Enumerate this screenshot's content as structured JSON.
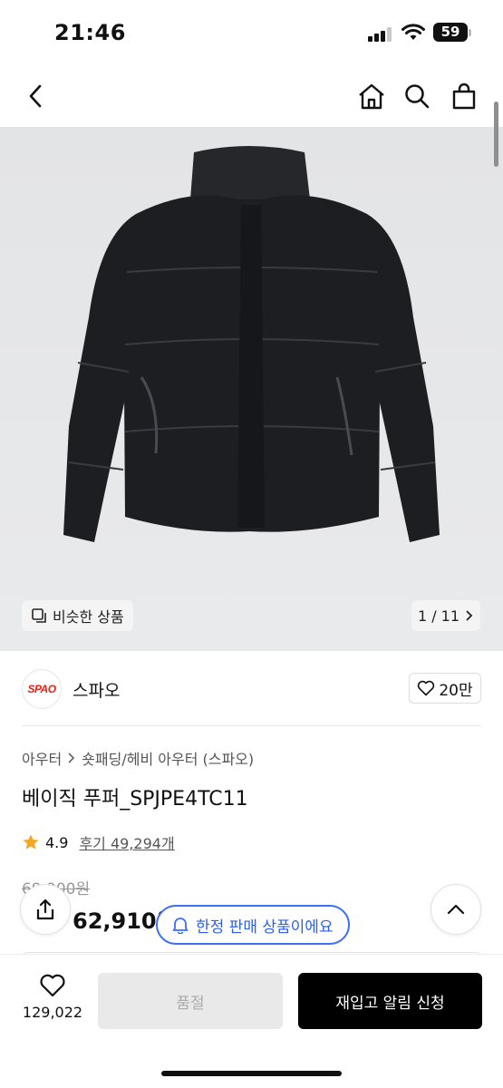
{
  "status_bar": {
    "time": "21:46",
    "battery": "59"
  },
  "product": {
    "similar_label": "비슷한 상품",
    "pager": "1 / 11",
    "brand_logo_text": "SPAO",
    "brand_name": "스파오",
    "brand_likes": "20만",
    "breadcrumb": [
      "아우터",
      "숏패딩/헤비 아우터 (스파오)"
    ],
    "title": "베이직 푸퍼_SPJPE4TC11",
    "rating": "4.9",
    "reviews": "후기 49,294개",
    "original_price": "69,900원",
    "sale_price": "62,910원",
    "limited_badge": "한정 판매 상품이에요"
  },
  "bottom_bar": {
    "wish_count": "129,022",
    "soldout_label": "품절",
    "restock_label": "재입고 알림 신청"
  },
  "colors": {
    "accent_blue": "#3d6ef5",
    "brand_red": "#e2231a",
    "star": "#f5a623"
  }
}
